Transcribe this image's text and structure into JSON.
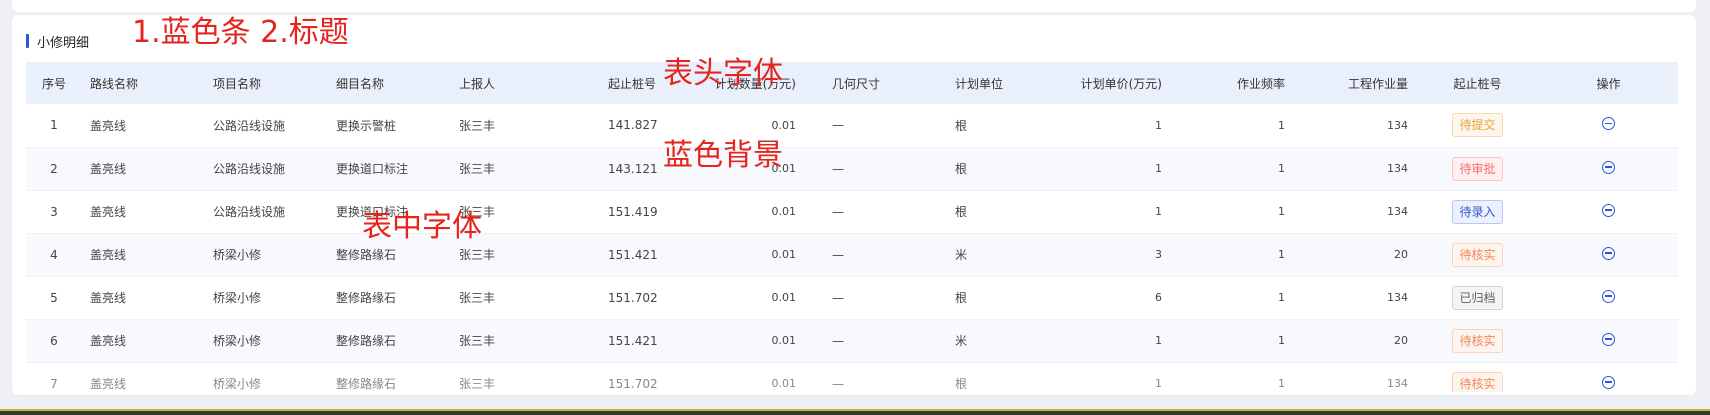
{
  "section": {
    "title": "小修明细"
  },
  "annotations": {
    "title_note": "1.蓝色条  2.标题",
    "header_font_note": "表头字体",
    "blue_bg_note": "蓝色背景",
    "cell_font_note": "表中字体"
  },
  "colors": {
    "accent": "#2f55d4",
    "header_bg": "#eaf0fb",
    "annotation": "#e6241e"
  },
  "table": {
    "columns": [
      "序号",
      "路线名称",
      "项目名称",
      "细目名称",
      "上报人",
      "起止桩号",
      "计划数量(万元)",
      "几何尺寸",
      "计划单位",
      "计划单价(万元)",
      "作业频率",
      "工程作业量",
      "起止桩号",
      "操作"
    ],
    "rows": [
      {
        "no": "1",
        "route": "盖亮线",
        "project": "公路沿线设施",
        "item": "更换示警桩",
        "reporter": "张三丰",
        "stake": "141.827",
        "qty": "0.01",
        "size": "—",
        "unit": "根",
        "price": "1",
        "freq": "1",
        "volume": "134",
        "status": "待提交",
        "status_color": "#e6a23c",
        "status_bg": "#fdf6ec",
        "status_border": "#f5dab1",
        "op_icon": "minus-circle-icon"
      },
      {
        "no": "2",
        "route": "盖亮线",
        "project": "公路沿线设施",
        "item": "更换道口标注",
        "reporter": "张三丰",
        "stake": "143.121",
        "qty": "0.01",
        "size": "—",
        "unit": "根",
        "price": "1",
        "freq": "1",
        "volume": "134",
        "status": "待审批",
        "status_color": "#f56c6c",
        "status_bg": "#fef0f0",
        "status_border": "#fbc4c4",
        "op_icon": "minus-circle-icon"
      },
      {
        "no": "3",
        "route": "盖亮线",
        "project": "公路沿线设施",
        "item": "更换道口标注",
        "reporter": "张三丰",
        "stake": "151.419",
        "qty": "0.01",
        "size": "—",
        "unit": "根",
        "price": "1",
        "freq": "1",
        "volume": "134",
        "status": "待录入",
        "status_color": "#2f55d4",
        "status_bg": "#ecf1fd",
        "status_border": "#b8c8f3",
        "op_icon": "minus-circle-icon"
      },
      {
        "no": "4",
        "route": "盖亮线",
        "project": "桥梁小修",
        "item": "整修路缘石",
        "reporter": "张三丰",
        "stake": "151.421",
        "qty": "0.01",
        "size": "—",
        "unit": "米",
        "price": "3",
        "freq": "1",
        "volume": "20",
        "status": "待核实",
        "status_color": "#f0885a",
        "status_bg": "#fef4ee",
        "status_border": "#f9d3bf",
        "op_icon": "minus-circle-icon"
      },
      {
        "no": "5",
        "route": "盖亮线",
        "project": "桥梁小修",
        "item": "整修路缘石",
        "reporter": "张三丰",
        "stake": "151.702",
        "qty": "0.01",
        "size": "—",
        "unit": "根",
        "price": "6",
        "freq": "1",
        "volume": "134",
        "status": "已归档",
        "status_color": "#606266",
        "status_bg": "#f4f4f5",
        "status_border": "#d3d4d6",
        "op_icon": "minus-circle-icon"
      },
      {
        "no": "6",
        "route": "盖亮线",
        "project": "桥梁小修",
        "item": "整修路缘石",
        "reporter": "张三丰",
        "stake": "151.421",
        "qty": "0.01",
        "size": "—",
        "unit": "米",
        "price": "1",
        "freq": "1",
        "volume": "20",
        "status": "待核实",
        "status_color": "#f0885a",
        "status_bg": "#fef4ee",
        "status_border": "#f9d3bf",
        "op_icon": "minus-circle-icon"
      },
      {
        "no": "7",
        "route": "盖亮线",
        "project": "桥梁小修",
        "item": "整修路缘石",
        "reporter": "张三丰",
        "stake": "151.702",
        "qty": "0.01",
        "size": "—",
        "unit": "根",
        "price": "1",
        "freq": "1",
        "volume": "134",
        "status": "待核实",
        "status_color": "#f0885a",
        "status_bg": "#fef4ee",
        "status_border": "#f9d3bf",
        "op_icon": "minus-circle-icon"
      }
    ]
  }
}
